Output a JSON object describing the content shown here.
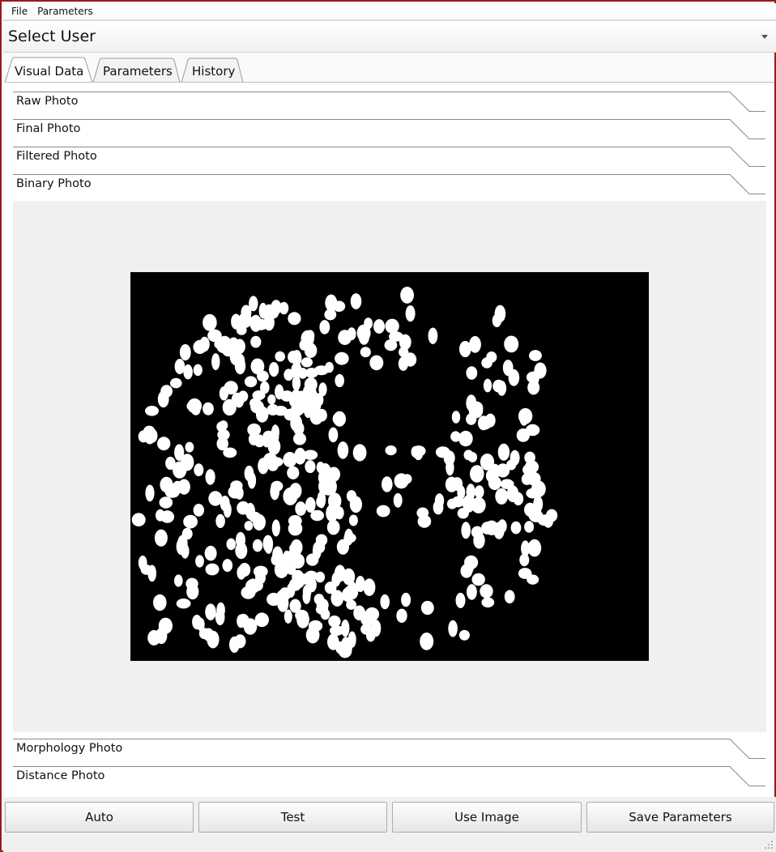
{
  "menu": {
    "items": [
      {
        "label": "File"
      },
      {
        "label": "Parameters"
      }
    ]
  },
  "user_select": {
    "selected": "Select User",
    "icon": "chevron-down-icon"
  },
  "tabs": [
    {
      "label": "Visual Data",
      "active": true
    },
    {
      "label": "Parameters",
      "active": false
    },
    {
      "label": "History",
      "active": false
    }
  ],
  "sections": {
    "raw_photo": "Raw Photo",
    "final_photo": "Final Photo",
    "filtered_photo": "Filtered Photo",
    "binary_photo": "Binary Photo",
    "morphology_photo": "Morphology Photo",
    "distance_photo": "Distance Photo"
  },
  "binary_image": {
    "content": "black background with white cell blobs"
  },
  "buttons": {
    "auto": "Auto",
    "test": "Test",
    "use_image": "Use Image",
    "save_parameters": "Save Parameters"
  },
  "colors": {
    "window_border": "#9a1a1a",
    "image_bg": "#000000",
    "blob": "#ffffff"
  }
}
